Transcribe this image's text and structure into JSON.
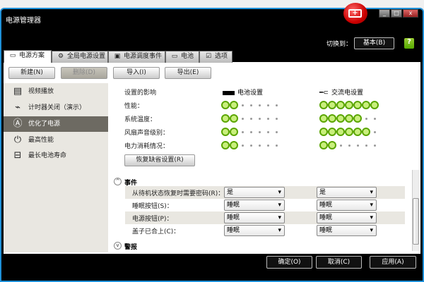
{
  "window": {
    "title": "电源管理器",
    "controls": [
      "_",
      "□",
      "x"
    ]
  },
  "header": {
    "switch_label": "切换到：",
    "basic_button": "基本(B)",
    "help": "?"
  },
  "tabs": [
    {
      "label": "电源方案",
      "icon": "document-icon"
    },
    {
      "label": "全局电源设置",
      "icon": "gear-icon"
    },
    {
      "label": "电源调度事件",
      "icon": "schedule-icon"
    },
    {
      "label": "电池",
      "icon": "battery-icon"
    },
    {
      "label": "选项",
      "icon": "checkbox-icon"
    }
  ],
  "toolbar": {
    "new": "新建(N)",
    "delete": "删除(D)",
    "import": "导入(I)",
    "export": "导出(E)"
  },
  "plans": [
    {
      "label": "视频播放",
      "icon": "film-icon"
    },
    {
      "label": "计时器关闭（演示）",
      "icon": "timer-off-icon"
    },
    {
      "label": "优化了电源",
      "icon": "auto-icon",
      "selected": true
    },
    {
      "label": "最高性能",
      "icon": "power-icon"
    },
    {
      "label": "最长电池寿命",
      "icon": "battery-clock-icon"
    }
  ],
  "impact": {
    "title": "设置的影响",
    "battery_header": "电池设置",
    "ac_header": "交流电设置",
    "rows": [
      {
        "label": "性能：",
        "battery": 2,
        "ac": 7
      },
      {
        "label": "系统温度：",
        "battery": 2,
        "ac": 5
      },
      {
        "label": "风扇声音级别：",
        "battery": 2,
        "ac": 6
      },
      {
        "label": "电力消耗情况：",
        "battery": 2,
        "ac": 2
      }
    ],
    "max_level": 7,
    "restore": "恢复缺省设置(R)"
  },
  "events": {
    "title": "事件",
    "rows": [
      {
        "label": "从待机状态恢复时需要密码(R)：",
        "battery": "是",
        "ac": "是"
      },
      {
        "label": "睡眠按钮(S)：",
        "battery": "睡眠",
        "ac": "睡眠"
      },
      {
        "label": "电源按钮(P)：",
        "battery": "睡眠",
        "ac": "睡眠"
      },
      {
        "label": "盖子已合上(C)：",
        "battery": "睡眠",
        "ac": "睡眠"
      }
    ]
  },
  "alerts": {
    "title": "警报"
  },
  "footer": {
    "ok": "确定(O)",
    "cancel": "取消(C)",
    "apply": "应用(A)"
  },
  "colors": {
    "accent": "#5aa500",
    "selected": "#6d6a62",
    "frame": "#000000"
  }
}
